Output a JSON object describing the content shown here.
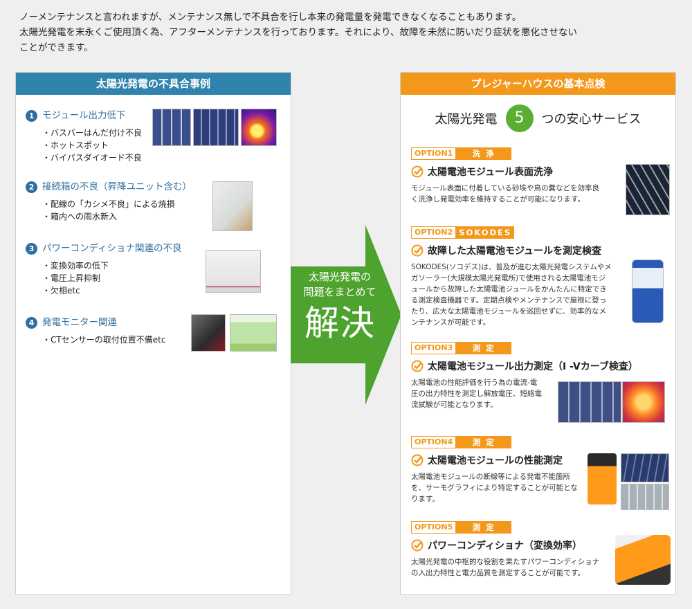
{
  "intro": {
    "line1": "ノーメンテナンスと言われますが、メンテナンス無しで不具合を行し本来の発電量を発電できなくなることもあります。",
    "line2": "太陽光発電を末永くご使用頂く為、アフターメンテナンスを行っております。それにより、故障を未然に防いだり症状を悪化させない",
    "line3": "ことができます。"
  },
  "left": {
    "title": "太陽光発電の不具合事例",
    "issues": [
      {
        "num": "1",
        "title": "モジュール出力低下",
        "items": [
          "バスバーはんだ付け不良",
          "ホットスポット",
          "バイパスダイオード不良"
        ]
      },
      {
        "num": "2",
        "title": "接続箱の不良（昇降ユニット含む）",
        "items": [
          "配線の「カシメ不良」による焼損",
          "箱内への雨水新入"
        ]
      },
      {
        "num": "3",
        "title": "パワーコンディショナ関連の不良",
        "items": [
          "変換効率の低下",
          "電圧上昇抑制",
          "欠相etc"
        ]
      },
      {
        "num": "4",
        "title": "発電モニター関連",
        "items": [
          "CTセンサーの取付位置不備etc"
        ]
      }
    ]
  },
  "arrow": {
    "line1": "太陽光発電の",
    "line2": "問題をまとめて",
    "big": "解決"
  },
  "right": {
    "title": "プレジャーハウスの基本点検",
    "sub_before": "太陽光発電",
    "sub_num": "5",
    "sub_after": "つの安心サービス",
    "options": [
      {
        "tag": "OPTION1",
        "label": "洗 浄",
        "title": "太陽電池モジュール表面洗浄",
        "body": "モジュール表面に付着している砂埃や鳥の糞などを効率良く洗浄し発電効率を維持することが可能になります。"
      },
      {
        "tag": "OPTION2",
        "label": "SOKODES",
        "title": "故障した太陽電池モジュールを測定検査",
        "body": "SOKODES(ソコデス)は、普及が進む太陽光発電システムやメガソーラー(大規模太陽光発電所)で使用される太陽電池モジュールから故障した太陽電池ジュールをかんたんに特定できる測定検査機器です。定期点検やメンテナンスで屋根に登ったり、広大な太陽電池モジュールを巡回せずに、効率的なメンテナンスが可能です。"
      },
      {
        "tag": "OPTION3",
        "label": "測 定",
        "title": "太陽電池モジュール出力測定（I -Vカーブ検査）",
        "body": "太陽電池の性能評価を行う為の電流-電圧の出力特性を測定し解放電圧、短絡電流試験が可能となります。"
      },
      {
        "tag": "OPTION4",
        "label": "測 定",
        "title": "太陽電池モジュールの性能測定",
        "body": "太陽電池モジュールの断線等による発電不能箇所を、サーモグラフィにより特定することが可能となります。"
      },
      {
        "tag": "OPTION5",
        "label": "測 定",
        "title": "パワーコンディショナ（変換効率）",
        "body": "太陽光発電の中枢的な役割を果たすパワーコンディショナの入出力特性と電力品質を測定することが可能です。"
      }
    ]
  },
  "colors": {
    "blue": "#2f83ac",
    "orange": "#f3981b",
    "green": "#5aae34",
    "arrow_green": "#4ea32e"
  }
}
